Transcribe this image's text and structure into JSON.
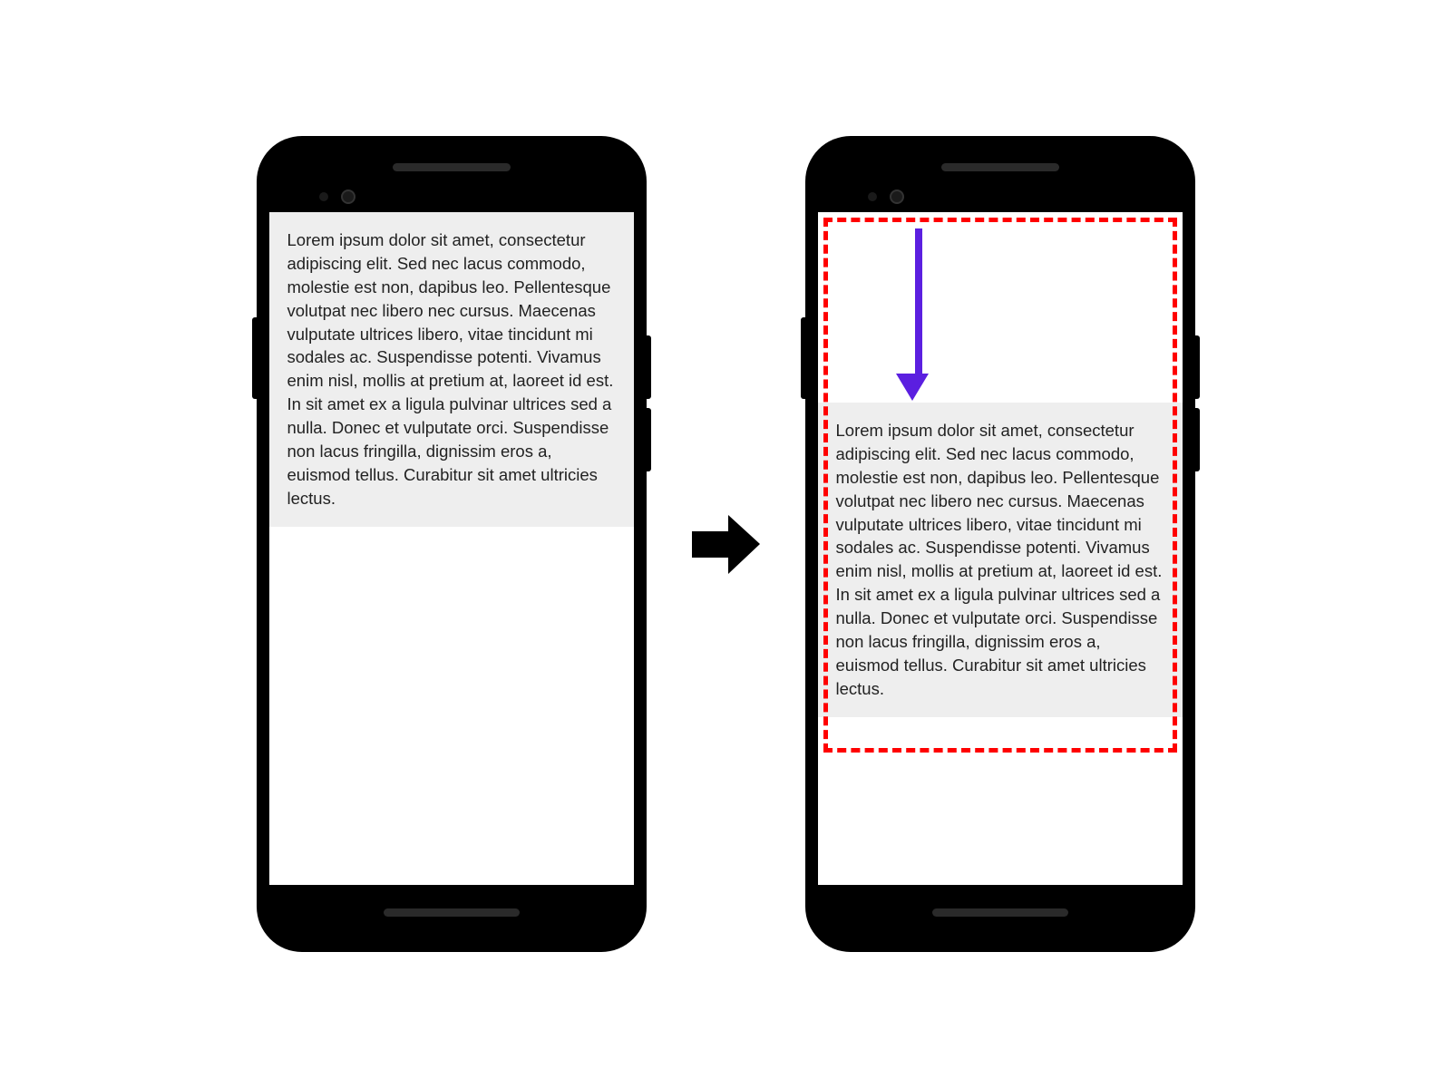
{
  "lorem_text": "Lorem ipsum dolor sit amet, consectetur adipiscing elit. Sed nec lacus commodo, molestie est non, dapibus leo. Pellentesque volutpat nec libero nec cursus. Maecenas vulputate ultrices libero, vitae tincidunt mi sodales ac. Suspendisse potenti. Vivamus enim nisl, mollis at pretium at, laoreet id est. In sit amet ex a ligula pulvinar ultrices sed a nulla. Donec et vulputate orci. Suspendisse non lacus fringilla, dignissim eros a, euismod tellus. Curabitur sit amet ultricies lectus.",
  "colors": {
    "highlight_border": "#ff0000",
    "arrow_down": "#5b1fe0",
    "transition_arrow": "#000000",
    "text_bg": "#eeeeee"
  }
}
